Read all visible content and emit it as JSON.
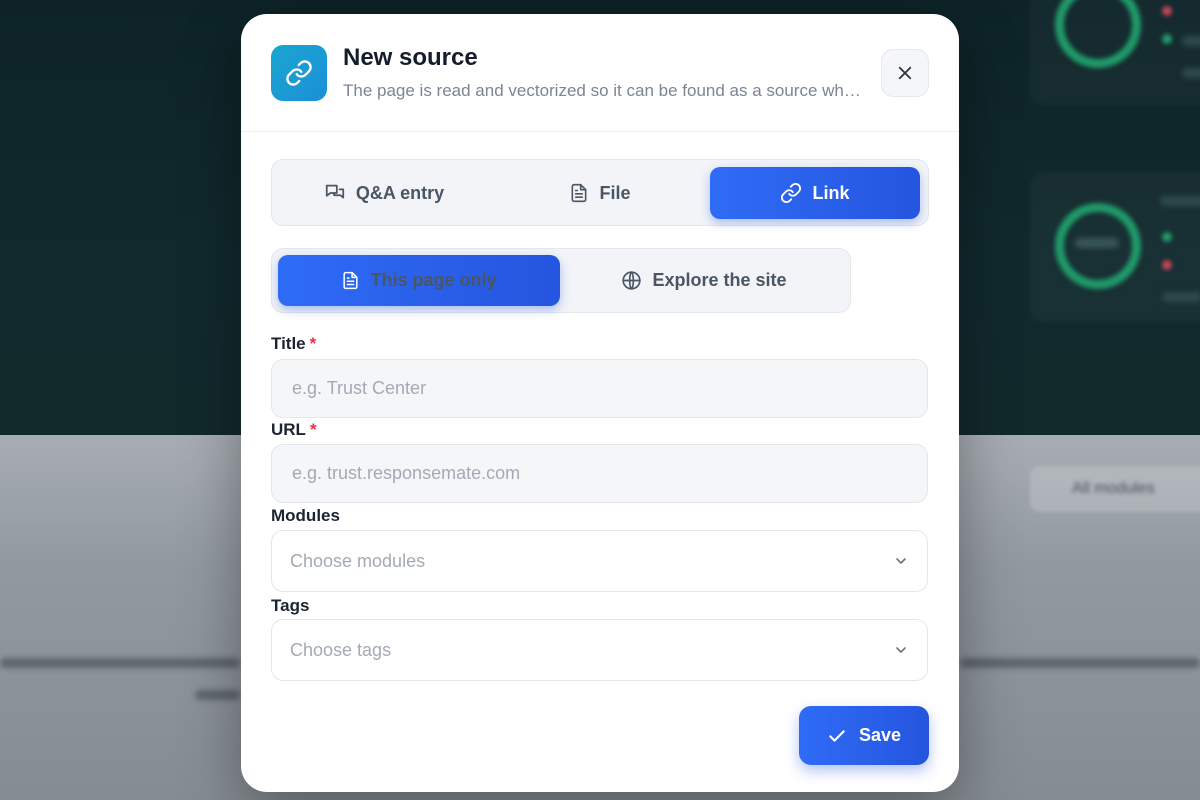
{
  "background": {
    "blurred_texts": [
      "All modules"
    ]
  },
  "modal": {
    "title": "New source",
    "subtitle": "The page is read and vectorized so it can be found as a source wh…",
    "header_icon": "link-icon",
    "close_icon": "close-icon"
  },
  "source_tabs": [
    {
      "label": "Q&A entry",
      "icon": "chat-bubbles-icon",
      "active": false
    },
    {
      "label": "File",
      "icon": "document-icon",
      "active": false
    },
    {
      "label": "Link",
      "icon": "link-icon",
      "active": true
    }
  ],
  "scope_tabs": [
    {
      "label": "This page only",
      "icon": "document-icon",
      "active": true
    },
    {
      "label": "Explore the site",
      "icon": "globe-icon",
      "active": false
    }
  ],
  "form": {
    "title": {
      "label": "Title",
      "required_mark": "*",
      "placeholder": "e.g. Trust Center",
      "value": ""
    },
    "url": {
      "label": "URL",
      "required_mark": "*",
      "placeholder": "e.g. trust.responsemate.com",
      "value": ""
    },
    "modules": {
      "label": "Modules",
      "placeholder": "Choose modules"
    },
    "tags": {
      "label": "Tags",
      "placeholder": "Choose tags"
    }
  },
  "actions": {
    "save_label": "Save",
    "save_icon": "check-icon"
  },
  "colors": {
    "accent": "#2f6cf6",
    "required": "#e0344a",
    "header_icon_bg": "#1ba6cf"
  }
}
